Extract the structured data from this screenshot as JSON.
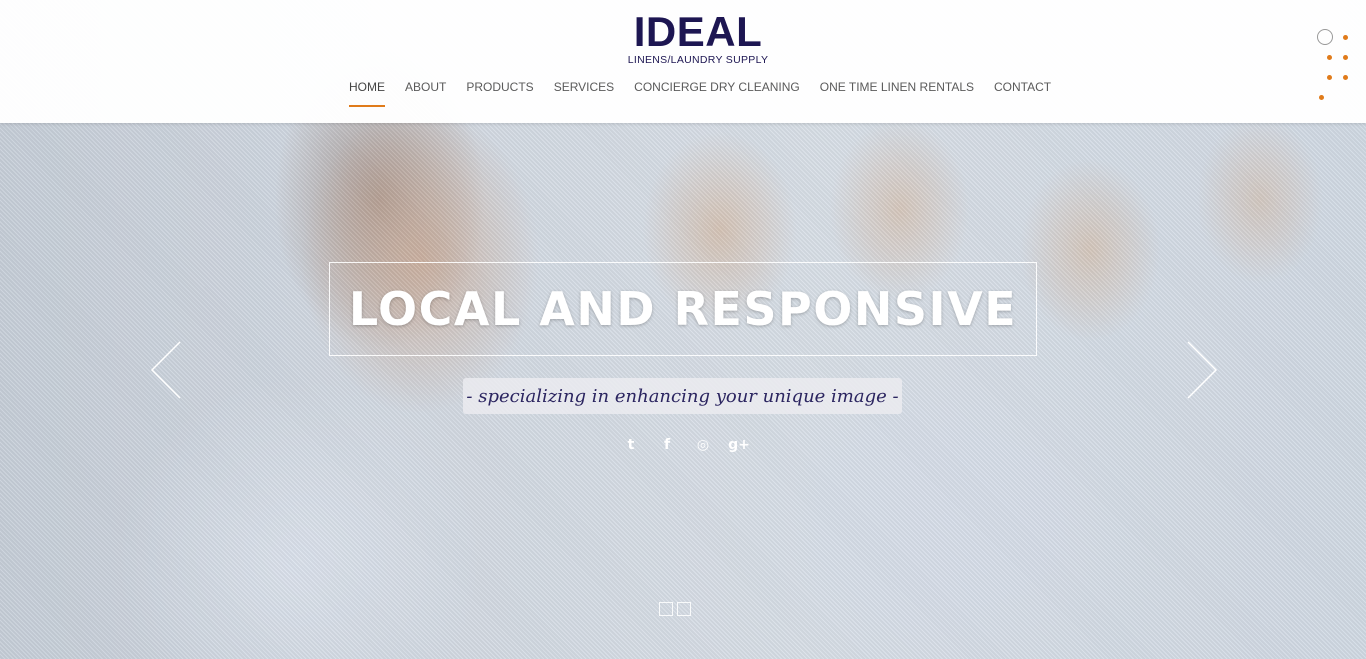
{
  "brand": {
    "name": "IDEAL",
    "subtitle": "LINENS/LAUNDRY SUPPLY",
    "primary_color": "#1d1652",
    "accent_color": "#e07b1a"
  },
  "nav": {
    "items": [
      {
        "label": "HOME",
        "active": true
      },
      {
        "label": "ABOUT"
      },
      {
        "label": "PRODUCTS"
      },
      {
        "label": "SERVICES"
      },
      {
        "label": "CONCIERGE DRY CLEANING"
      },
      {
        "label": "ONE TIME LINEN RENTALS"
      },
      {
        "label": "CONTACT"
      }
    ]
  },
  "hero": {
    "headline": "LOCAL AND RESPONSIVE",
    "tagline": "- specializing in enhancing your unique image -",
    "social": [
      {
        "icon": "twitter-icon",
        "glyph": "t"
      },
      {
        "icon": "facebook-icon",
        "glyph": "f"
      },
      {
        "icon": "github-icon",
        "glyph": "◎"
      },
      {
        "icon": "google-plus-icon",
        "glyph": "g+"
      }
    ],
    "prev_icon": "chevron-left-icon",
    "next_icon": "chevron-right-icon"
  }
}
